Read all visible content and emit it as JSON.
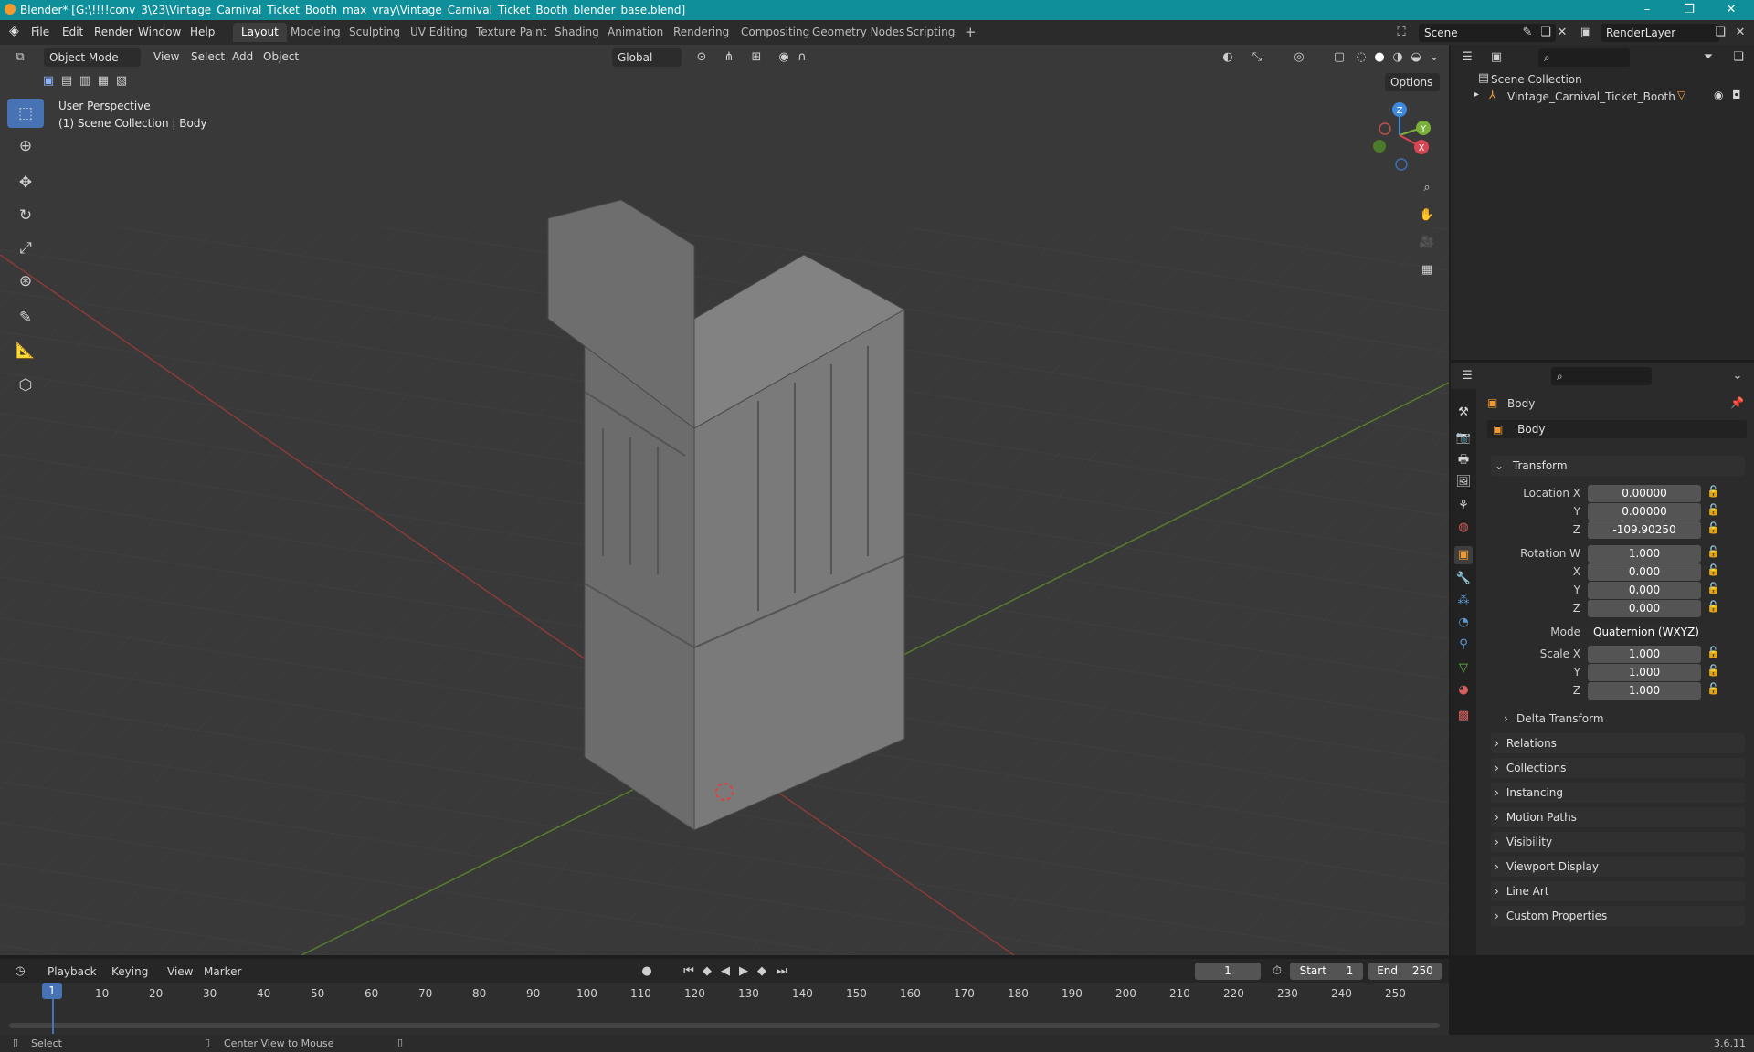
{
  "window": {
    "title": "Blender* [G:\\!!!!conv_3\\23\\Vintage_Carnival_Ticket_Booth_max_vray\\Vintage_Carnival_Ticket_Booth_blender_base.blend]",
    "minimize": "–",
    "restore": "❐",
    "close": "✕"
  },
  "menu": {
    "file": "File",
    "edit": "Edit",
    "render": "Render",
    "window": "Window",
    "help": "Help"
  },
  "workspaces": [
    "Layout",
    "Modeling",
    "Sculpting",
    "UV Editing",
    "Texture Paint",
    "Shading",
    "Animation",
    "Rendering",
    "Compositing",
    "Geometry Nodes",
    "Scripting"
  ],
  "workspace_add": "+",
  "scene_field": "Scene",
  "renderlayer_field": "RenderLayer",
  "viewport": {
    "mode": "Object Mode",
    "menus": {
      "view": "View",
      "select": "Select",
      "add": "Add",
      "object": "Object"
    },
    "transform_orientation": "Global",
    "options": "Options",
    "perspective": "User Perspective",
    "collection_info": "(1) Scene Collection | Body",
    "axes": {
      "x": "X",
      "y": "Y",
      "z": "Z"
    }
  },
  "outliner": {
    "root": "Scene Collection",
    "items": [
      {
        "label": "Vintage_Carnival_Ticket_Booth"
      }
    ]
  },
  "properties": {
    "object_name": "Body",
    "datablock_name": "Body",
    "transform_header": "Transform",
    "location": {
      "label_x": "Location X",
      "label_y": "Y",
      "label_z": "Z",
      "x": "0.00000",
      "y": "0.00000",
      "z": "-109.90250"
    },
    "rotation": {
      "label_w": "Rotation W",
      "label_x": "X",
      "label_y": "Y",
      "label_z": "Z",
      "w": "1.000",
      "x": "0.000",
      "y": "0.000",
      "z": "0.000"
    },
    "mode_label": "Mode",
    "mode_value": "Quaternion (WXYZ)",
    "scale": {
      "label_x": "Scale X",
      "label_y": "Y",
      "label_z": "Z",
      "x": "1.000",
      "y": "1.000",
      "z": "1.000"
    },
    "delta": "Delta Transform",
    "panels": [
      "Relations",
      "Collections",
      "Instancing",
      "Motion Paths",
      "Visibility",
      "Viewport Display",
      "Line Art",
      "Custom Properties"
    ]
  },
  "timeline": {
    "menus": {
      "playback": "Playback",
      "keying": "Keying",
      "view": "View",
      "marker": "Marker"
    },
    "current_frame": "1",
    "start_label": "Start",
    "start": "1",
    "end_label": "End",
    "end": "250",
    "ticks": [
      "10",
      "20",
      "30",
      "40",
      "50",
      "60",
      "70",
      "80",
      "90",
      "100",
      "110",
      "120",
      "130",
      "140",
      "150",
      "160",
      "170",
      "180",
      "190",
      "200",
      "210",
      "220",
      "230",
      "240",
      "250"
    ],
    "playhead": "1"
  },
  "status": {
    "select": "Select",
    "center_view": "Center View to Mouse",
    "version": "3.6.11"
  },
  "colors": {
    "accent": "#4772b3",
    "titlebar": "#0f8f9a",
    "x_axis": "#d94452",
    "y_axis": "#7ab03a",
    "z_axis": "#3c8be0"
  }
}
